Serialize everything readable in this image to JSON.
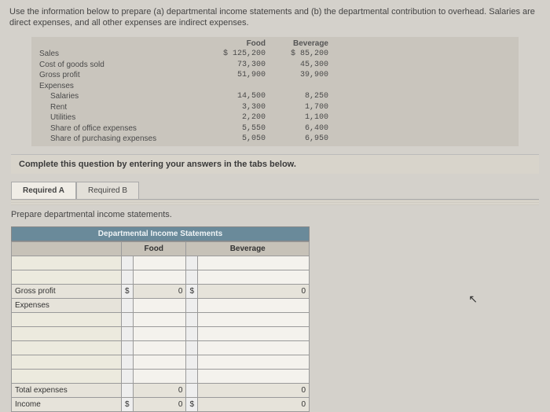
{
  "instructions": "Use the information below to prepare (a) departmental income statements and (b) the departmental contribution to overhead. Salaries are direct expenses, and all other expenses are indirect expenses.",
  "data_table": {
    "headers": [
      "Food",
      "Beverage"
    ],
    "rows": [
      {
        "label": "Sales",
        "indent": false,
        "food": "$ 125,200",
        "bev": "$ 85,200"
      },
      {
        "label": "Cost of goods sold",
        "indent": false,
        "food": "73,300",
        "bev": "45,300"
      },
      {
        "label": "Gross profit",
        "indent": false,
        "food": "51,900",
        "bev": "39,900"
      },
      {
        "label": "Expenses",
        "indent": false,
        "food": "",
        "bev": ""
      },
      {
        "label": "Salaries",
        "indent": true,
        "food": "14,500",
        "bev": "8,250"
      },
      {
        "label": "Rent",
        "indent": true,
        "food": "3,300",
        "bev": "1,700"
      },
      {
        "label": "Utilities",
        "indent": true,
        "food": "2,200",
        "bev": "1,100"
      },
      {
        "label": "Share of office expenses",
        "indent": true,
        "food": "5,550",
        "bev": "6,400"
      },
      {
        "label": "Share of purchasing expenses",
        "indent": true,
        "food": "5,050",
        "bev": "6,950"
      }
    ]
  },
  "complete_text": "Complete this question by entering your answers in the tabs below.",
  "tabs": {
    "a": "Required A",
    "b": "Required B"
  },
  "sub_instruction": "Prepare departmental income statements.",
  "sheet": {
    "title": "Departmental Income Statements",
    "col_food": "Food",
    "col_bev": "Beverage",
    "gross_profit": "Gross profit",
    "expenses": "Expenses",
    "total_expenses": "Total expenses",
    "income": "Income",
    "zero": "0",
    "dollar": "$"
  }
}
